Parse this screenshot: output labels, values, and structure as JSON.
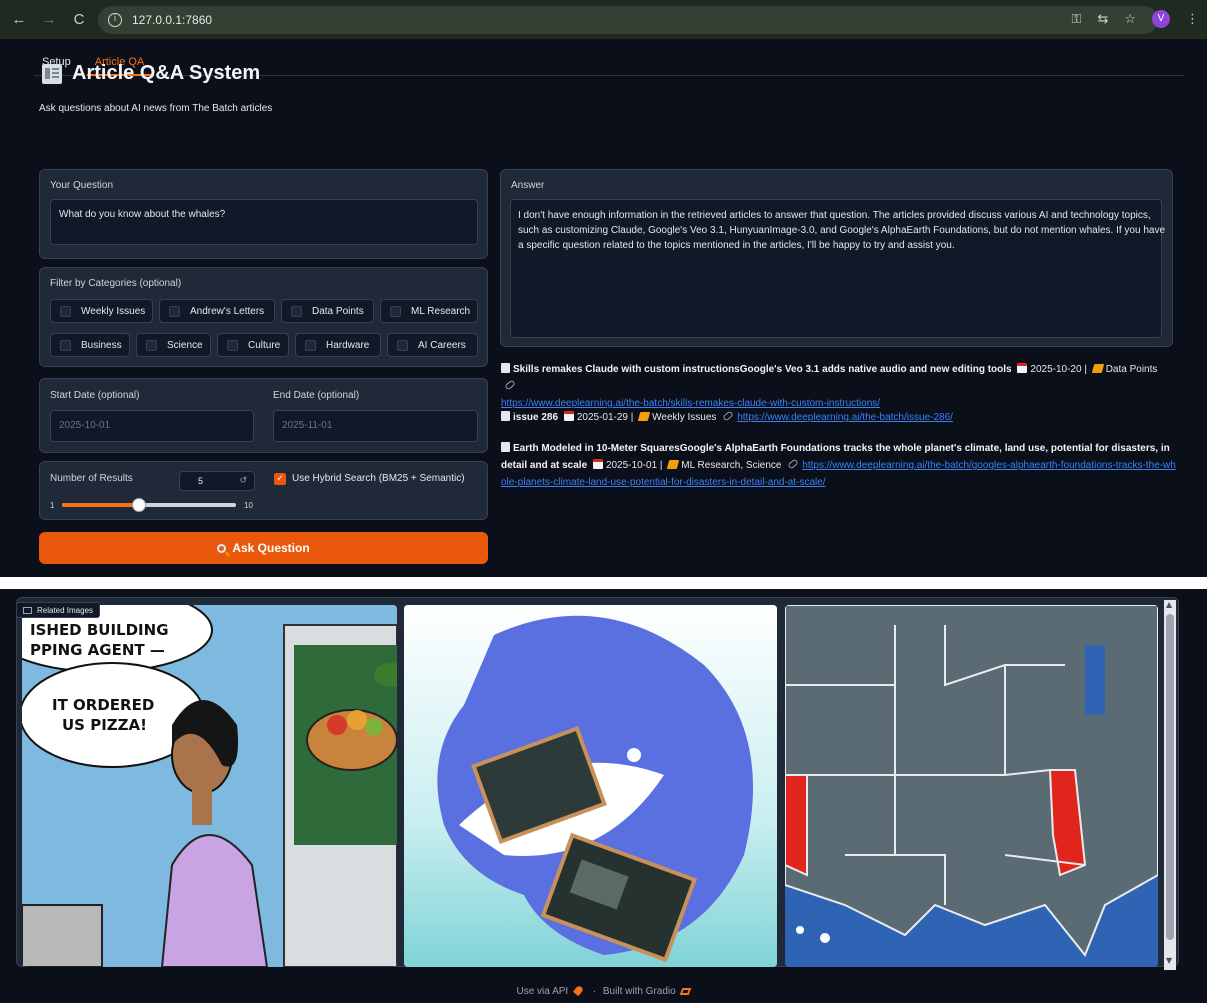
{
  "browser": {
    "url": "127.0.0.1:7860",
    "profile_initial": "V",
    "icons": [
      "back-icon",
      "forward-icon",
      "reload-icon",
      "site-info-icon",
      "password-key-icon",
      "translate-icon",
      "bookmark-star-icon",
      "menu-icon"
    ]
  },
  "tabs": [
    {
      "label": "Setup",
      "active": false
    },
    {
      "label": "Article QA",
      "active": true
    }
  ],
  "header": {
    "title": "Article Q&A System",
    "subtitle": "Ask questions about AI news from The Batch articles"
  },
  "question": {
    "label": "Your Question",
    "value": "What do you know about the whales?"
  },
  "categories": {
    "label": "Filter by Categories (optional)",
    "items": [
      "Weekly Issues",
      "Andrew's Letters",
      "Data Points",
      "ML Research",
      "Business",
      "Science",
      "Culture",
      "Hardware",
      "AI Careers"
    ]
  },
  "dates": {
    "start_label": "Start Date (optional)",
    "start_placeholder": "2025-10-01",
    "end_label": "End Date (optional)",
    "end_placeholder": "2025-11-01"
  },
  "results": {
    "label": "Number of Results",
    "value": "5",
    "min": "1",
    "max": "10",
    "reset_symbol": "↺"
  },
  "hybrid": {
    "label": "Use Hybrid Search (BM25 + Semantic)",
    "checked": true
  },
  "ask_button": {
    "label": "Ask Question",
    "icon": "magnifier-icon"
  },
  "answer": {
    "label": "Answer",
    "text": "I don't have enough information in the retrieved articles to answer that question. The articles provided discuss various AI and technology topics, such as customizing Claude, Google's Veo 3.1, HunyuanImage-3.0, and Google's AlphaEarth Foundations, but do not mention whales. If you have a specific question related to the topics mentioned in the articles, I'll be happy to try and assist you."
  },
  "sources": [
    {
      "title": "Skills remakes Claude with custom instructionsGoogle's Veo 3.1 adds native audio and new editing tools",
      "date": "2025-10-20",
      "category": "Data Points",
      "url": "https://www.deeplearning.ai/the-batch/skills-remakes-claude-with-custom-instructions/"
    },
    {
      "title": "issue 286",
      "date": "2025-01-29",
      "category": "Weekly Issues",
      "url": "https://www.deeplearning.ai/the-batch/issue-286/"
    },
    {
      "title": "Earth Modeled in 10-Meter SquaresGoogle's AlphaEarth Foundations tracks the whole planet's climate, land use, potential for disasters, in detail and at scale",
      "date": "2025-10-01",
      "category": "ML Research, Science",
      "url": "https://www.deeplearning.ai/the-batch/googles-alphaearth-foundations-tracks-the-whole-planets-climate-land-use-potential-for-disasters-in-detail-and-at-scale/"
    }
  ],
  "gallery": {
    "label": "Related Images",
    "comic_lines": [
      "ISHED BUILDING",
      "PPING AGENT —",
      "IT ORDERED",
      "US PIZZA!"
    ]
  },
  "footer": {
    "api_text": "Use via API",
    "separator": "·",
    "built_text": "Built with Gradio"
  },
  "colors": {
    "accent": "#ea580c",
    "link": "#3b82f6",
    "panel": "#1f2937",
    "background": "#0b0f19"
  }
}
